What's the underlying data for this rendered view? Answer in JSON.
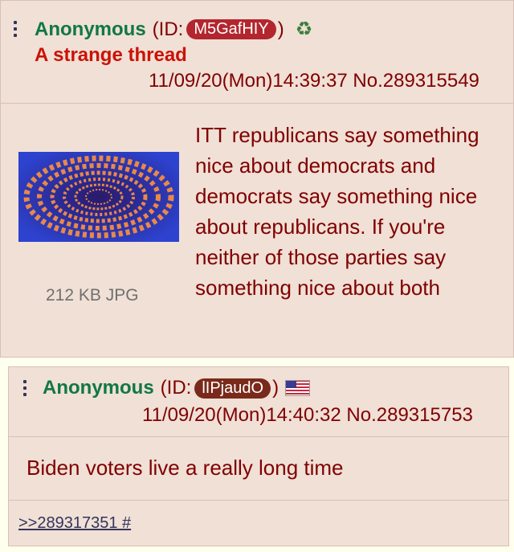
{
  "op": {
    "name": "Anonymous",
    "id_open": "(ID:",
    "id": "M5GafHIY",
    "id_close": ")",
    "recycle_icon": "♻",
    "subject": "A strange thread",
    "datetime": "11/09/20(Mon)14:39:37",
    "post_no": "No.289315549",
    "file_info": "212 KB JPG",
    "comment": "ITT republicans say something nice about democrats and democrats say something nice about republicans. If you're neither of those parties say something nice about both"
  },
  "reply": {
    "name": "Anonymous",
    "id_open": "(ID:",
    "id": "lIPjaudO",
    "id_close": ")",
    "flag_icon": "us-flag-icon",
    "datetime": "11/09/20(Mon)14:40:32",
    "post_no": "No.289315753",
    "comment": "Biden voters live a really long time",
    "backlink": ">>289317351 #"
  },
  "colors": {
    "post_bg": "#f0e0d6",
    "name": "#117743",
    "subject": "#cc1105",
    "text": "#800000",
    "link": "#34345c"
  }
}
